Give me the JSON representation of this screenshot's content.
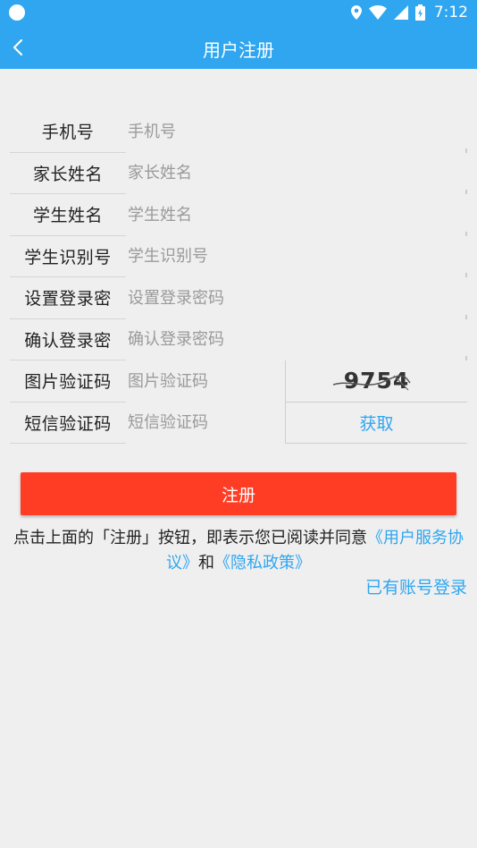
{
  "status_bar": {
    "time": "7:12",
    "icons": [
      "location-icon",
      "wifi-icon",
      "signal-icon",
      "battery-icon"
    ]
  },
  "app_bar": {
    "title": "用户注册",
    "back_icon": "chevron-left-icon"
  },
  "form": {
    "phone": {
      "label": "手机号",
      "placeholder": "手机号",
      "value": ""
    },
    "parent_name": {
      "label": "家长姓名",
      "placeholder": "家长姓名",
      "value": ""
    },
    "student_name": {
      "label": "学生姓名",
      "placeholder": "学生姓名",
      "value": ""
    },
    "student_id": {
      "label": "学生识别号",
      "placeholder": "学生识别号",
      "value": ""
    },
    "set_password": {
      "label": "设置登录密",
      "placeholder": "设置登录密码",
      "value": ""
    },
    "confirm_password": {
      "label": "确认登录密",
      "placeholder": "确认登录密码",
      "value": ""
    },
    "image_code": {
      "label": "图片验证码",
      "placeholder": "图片验证码",
      "value": "",
      "captcha": "9754"
    },
    "sms_code": {
      "label": "短信验证码",
      "placeholder": "短信验证码",
      "value": "",
      "get_label": "获取"
    }
  },
  "register_button": "注册",
  "agreement": {
    "prefix": "点击上面的「注册」按钮，即表示您已阅读并同意",
    "terms_link": "《用户服务协议》",
    "and": "和",
    "privacy_link": "《隐私政策》"
  },
  "login_link": "已有账号登录",
  "colors": {
    "primary": "#2fa6ef",
    "register": "#ff3d24",
    "background": "#efeff0"
  }
}
